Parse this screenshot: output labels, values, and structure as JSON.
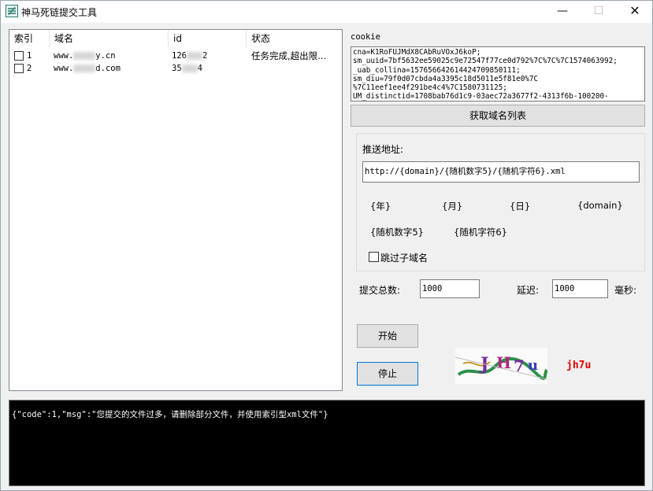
{
  "window": {
    "title": "神马死链提交工具",
    "icon": "app-logo-icon",
    "minimize": "—",
    "maximize": "☐",
    "close": "✕"
  },
  "list": {
    "columns": [
      "索引",
      "域名",
      "id",
      "状态"
    ],
    "rows": [
      {
        "index": "1",
        "domain_prefix": "www.",
        "domain_suffix": "y.cn",
        "id_prefix": "126",
        "id_suffix": "2",
        "status": "任务完成,超出限..."
      },
      {
        "index": "2",
        "domain_prefix": "www.",
        "domain_suffix": "d.com",
        "id_prefix": "35",
        "id_suffix": "4",
        "status": ""
      }
    ]
  },
  "cookie": {
    "label": "cookie",
    "value": "cna=K1RoFUJMdX8CAbRuVOxJ6koP;\nsm_uuid=7bf5632ee59025c9e72547f77ce0d792%7C%7C%7C1574063992;\n_uab_collina=157656642614424709850111;\nsm_diu=79f0d07cbda4a3395c18d5011e5f81e0%7C\n%7C11eef1ee4f291be4c4%7C1580731125;\nUM_distinctid=1708bab76d1c9-03aec72a3677f2-4313f6b-100200-"
  },
  "buttons": {
    "get_domains": "获取域名列表",
    "start": "开始",
    "stop": "停止"
  },
  "push": {
    "label": "推送地址:",
    "value": "http://{domain}/{随机数字5}/{随机字符6}.xml",
    "tokens": [
      "{年}",
      "{月}",
      "{日}",
      "{domain}",
      "{随机数字5}",
      "{随机字符6}"
    ],
    "skip_subdomain": "跳过子域名"
  },
  "settings": {
    "total_label": "提交总数:",
    "total_value": "1000",
    "delay_label": "延迟:",
    "delay_value": "1000",
    "unit_label": "毫秒:"
  },
  "captcha": {
    "answer": "jh7u",
    "answer_color": "#e60000"
  },
  "console": {
    "text": "{\"code\":1,\"msg\":\"您提交的文件过多，请删除部分文件，并使用索引型xml文件\"}"
  }
}
